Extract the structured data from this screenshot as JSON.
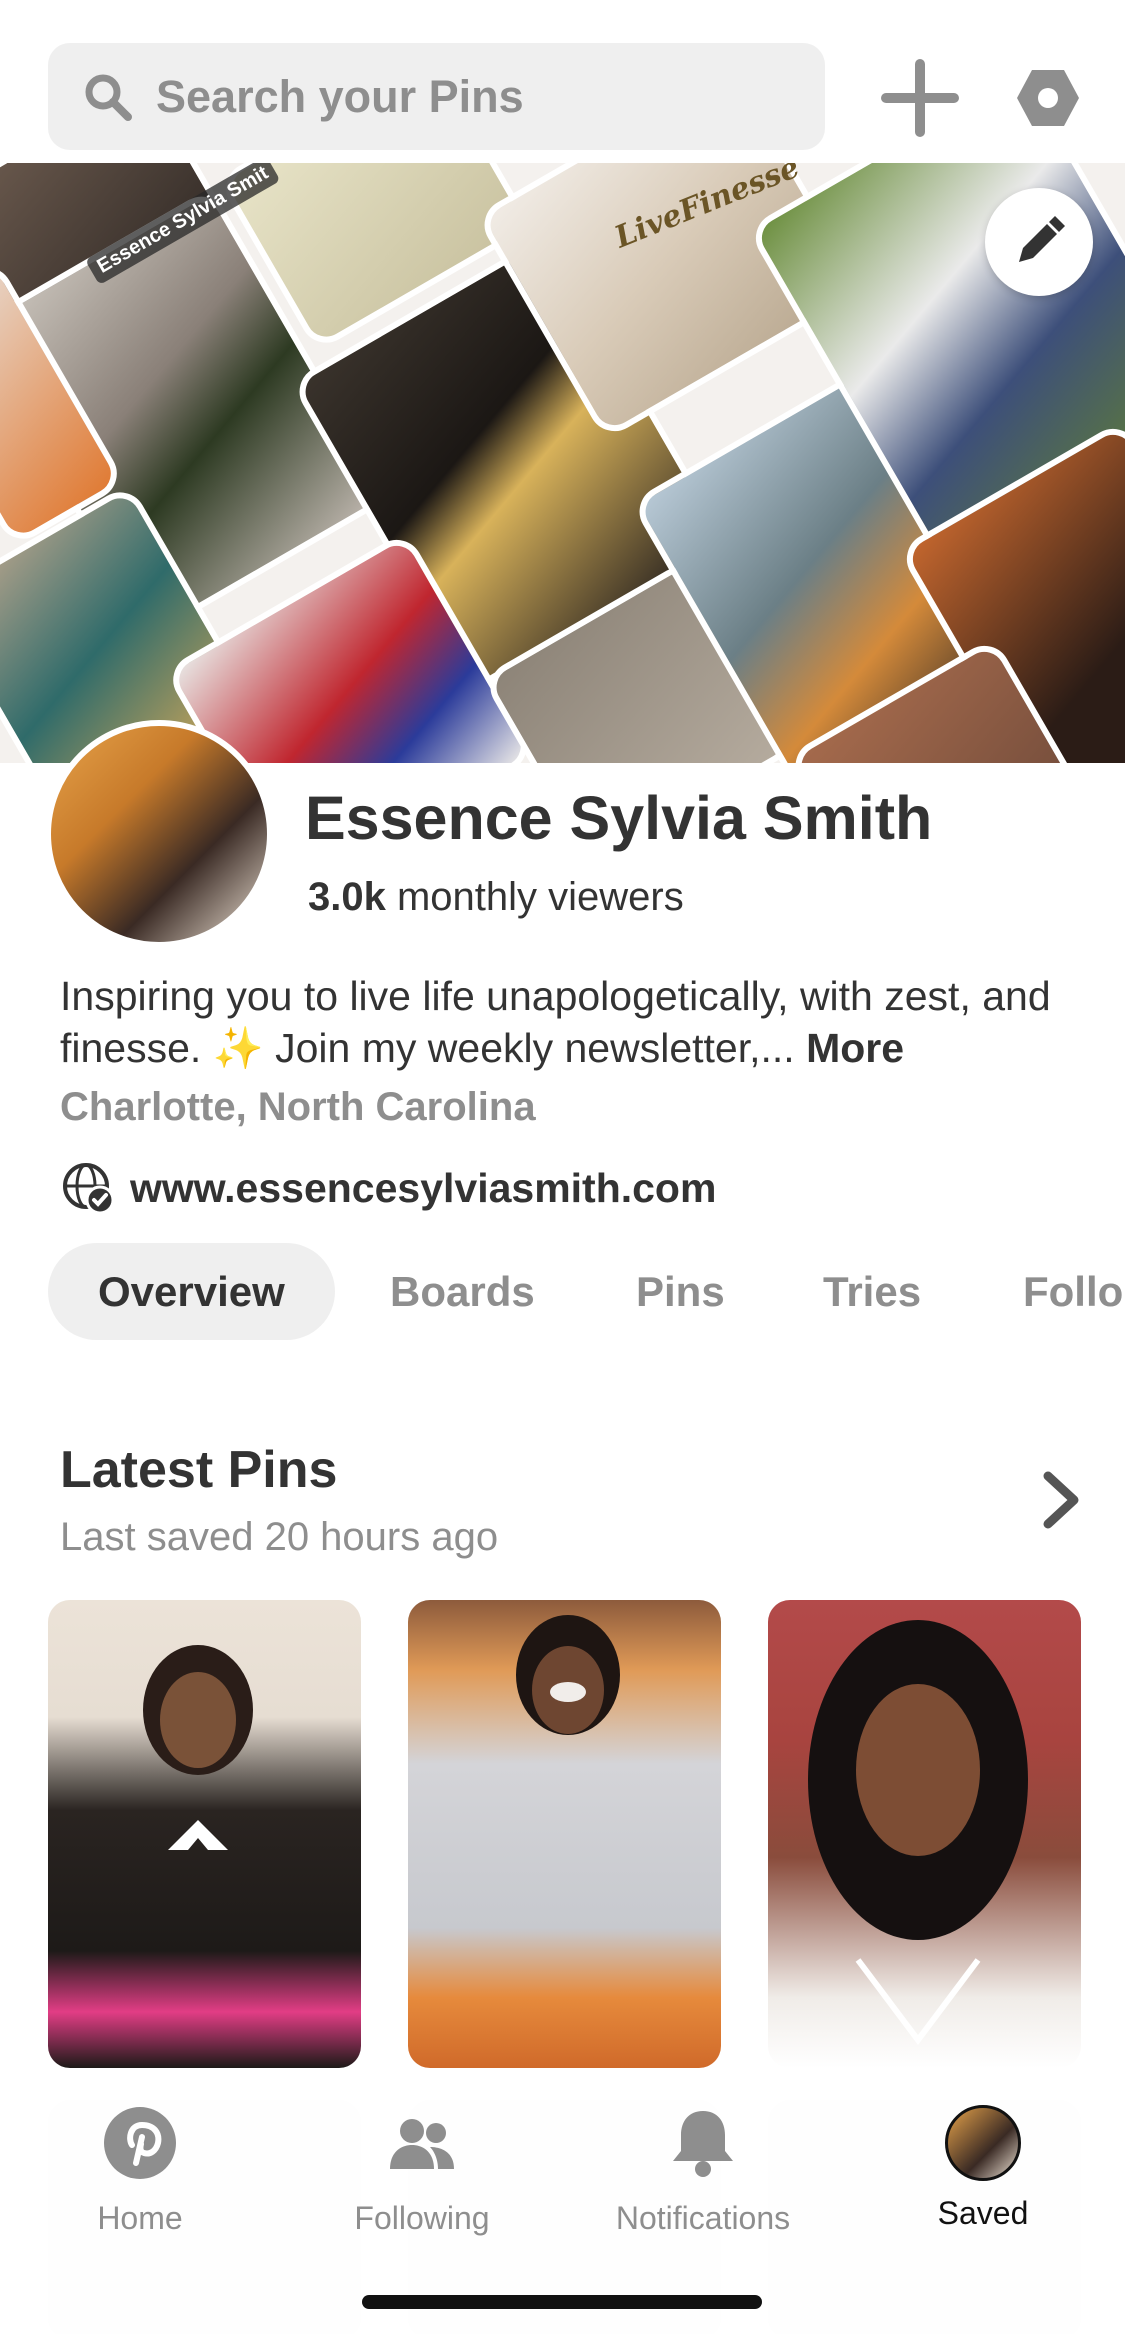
{
  "header": {
    "search_placeholder": "Search your Pins",
    "icons": [
      "search-icon",
      "plus-icon",
      "settings-hex-icon"
    ]
  },
  "cover": {
    "overlay_text": "Essence Sylvia Smit",
    "necklace_text": "LiveFinesse",
    "edit_icon": "pencil-icon"
  },
  "profile": {
    "name": "Essence Sylvia Smith",
    "viewers_count": "3.0k",
    "viewers_label": " monthly viewers",
    "bio": "Inspiring you to live life unapologetically, with zest, and finesse. ✨ Join my weekly newsletter,... ",
    "bio_more": "More",
    "location": "Charlotte, North Carolina",
    "website": "www.essencesylviasmith.com"
  },
  "tabs": [
    {
      "label": "Overview",
      "active": true
    },
    {
      "label": "Boards",
      "active": false
    },
    {
      "label": "Pins",
      "active": false
    },
    {
      "label": "Tries",
      "active": false
    },
    {
      "label": "Follo",
      "active": false
    }
  ],
  "latest": {
    "title": "Latest Pins",
    "subtitle": "Last saved 20 hours ago"
  },
  "nav": [
    {
      "label": "Home",
      "icon": "pinterest-logo-icon",
      "active": false
    },
    {
      "label": "Following",
      "icon": "people-icon",
      "active": false
    },
    {
      "label": "Notifications",
      "icon": "bell-icon",
      "active": false
    },
    {
      "label": "Saved",
      "icon": "avatar-icon",
      "active": true
    }
  ],
  "colors": {
    "text_dark": "#333333",
    "text_muted": "#8e8e8e",
    "chip_bg": "#efefef",
    "accent_red": "#e60023"
  }
}
